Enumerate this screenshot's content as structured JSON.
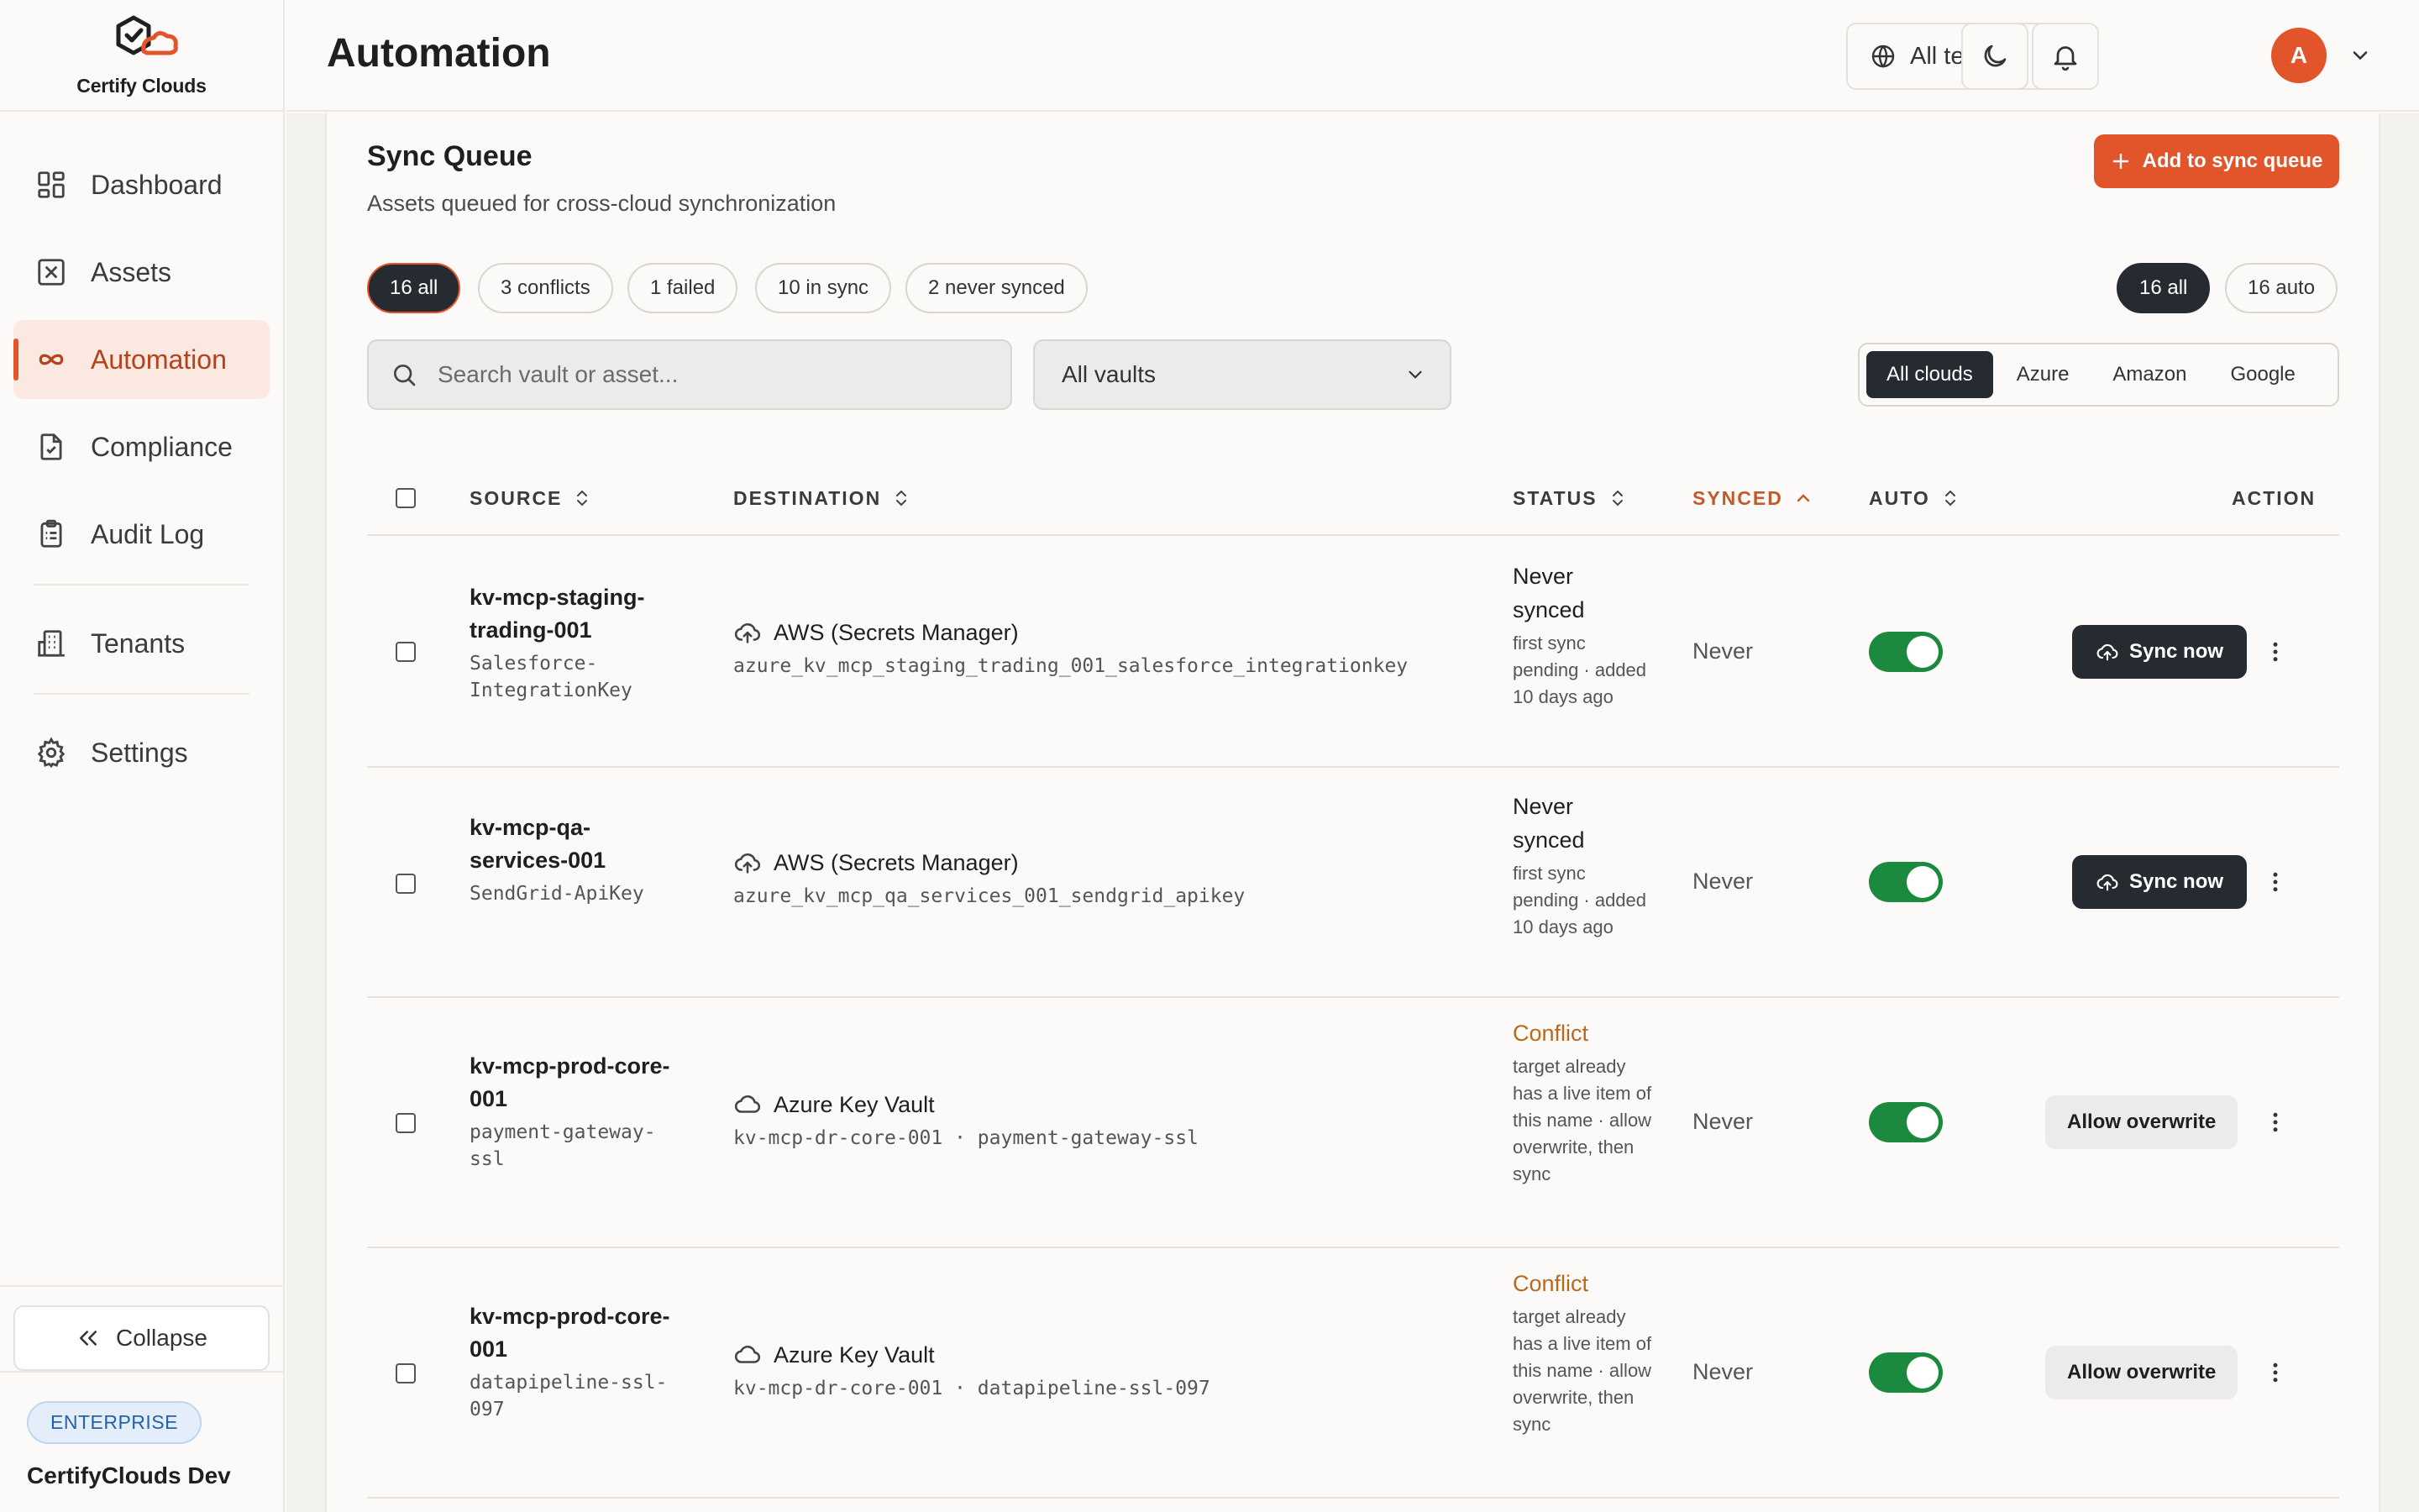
{
  "brand": {
    "name": "Certify Clouds",
    "accent": "#e2552a"
  },
  "sidebar": {
    "items": [
      {
        "label": "Dashboard",
        "icon": "dashboard-icon"
      },
      {
        "label": "Assets",
        "icon": "assets-icon"
      },
      {
        "label": "Automation",
        "icon": "infinity-icon",
        "active": true
      },
      {
        "label": "Compliance",
        "icon": "compliance-icon"
      },
      {
        "label": "Audit Log",
        "icon": "clipboard-icon"
      },
      {
        "label": "Tenants",
        "icon": "building-icon"
      },
      {
        "label": "Settings",
        "icon": "gear-icon"
      }
    ],
    "collapse_label": "Collapse",
    "plan_badge": "ENTERPRISE",
    "org_name": "CertifyClouds Dev"
  },
  "header": {
    "title": "Automation",
    "tenant_selector": "All tenants",
    "avatar_initial": "A"
  },
  "sync_queue": {
    "title": "Sync Queue",
    "subtitle": "Assets queued for cross-cloud synchronization",
    "add_button": "Add to sync queue",
    "status_filters": [
      "16 all",
      "3 conflicts",
      "1 failed",
      "10 in sync",
      "2 never synced"
    ],
    "mode_filters": [
      "16 all",
      "16 auto"
    ],
    "search_placeholder": "Search vault or asset...",
    "vault_select": "All vaults",
    "cloud_tabs": [
      "All clouds",
      "Azure",
      "Amazon",
      "Google"
    ],
    "columns": {
      "source": "SOURCE",
      "destination": "DESTINATION",
      "status": "STATUS",
      "synced": "SYNCED",
      "auto": "AUTO",
      "action": "ACTION"
    },
    "rows": [
      {
        "source_name": "kv-mcp-staging-trading-001",
        "source_key": "Salesforce-IntegrationKey",
        "dest_name": "AWS (Secrets Manager)",
        "dest_icon": "cloud-upload-icon",
        "dest_path": "azure_kv_mcp_staging_trading_001_salesforce_integrationkey",
        "status": "Never synced",
        "status_type": "never",
        "status_detail": "first sync pending · added 10 days ago",
        "synced": "Never",
        "auto": true,
        "action": "Sync now"
      },
      {
        "source_name": "kv-mcp-qa-services-001",
        "source_key": "SendGrid-ApiKey",
        "dest_name": "AWS (Secrets Manager)",
        "dest_icon": "cloud-upload-icon",
        "dest_path": "azure_kv_mcp_qa_services_001_sendgrid_apikey",
        "status": "Never synced",
        "status_type": "never",
        "status_detail": "first sync pending · added 10 days ago",
        "synced": "Never",
        "auto": true,
        "action": "Sync now"
      },
      {
        "source_name": "kv-mcp-prod-core-001",
        "source_key": "payment-gateway-ssl",
        "dest_name": "Azure Key Vault",
        "dest_icon": "cloud-icon",
        "dest_path": "kv-mcp-dr-core-001 · payment-gateway-ssl",
        "status": "Conflict",
        "status_type": "conflict",
        "status_detail": "target already has a live item of this name · allow overwrite, then sync",
        "synced": "Never",
        "auto": true,
        "action": "Allow overwrite"
      },
      {
        "source_name": "kv-mcp-prod-core-001",
        "source_key": "datapipeline-ssl-097",
        "dest_name": "Azure Key Vault",
        "dest_icon": "cloud-icon",
        "dest_path": "kv-mcp-dr-core-001 · datapipeline-ssl-097",
        "status": "Conflict",
        "status_type": "conflict",
        "status_detail": "target already has a live item of this name · allow overwrite, then sync",
        "synced": "Never",
        "auto": true,
        "action": "Allow overwrite"
      }
    ]
  }
}
